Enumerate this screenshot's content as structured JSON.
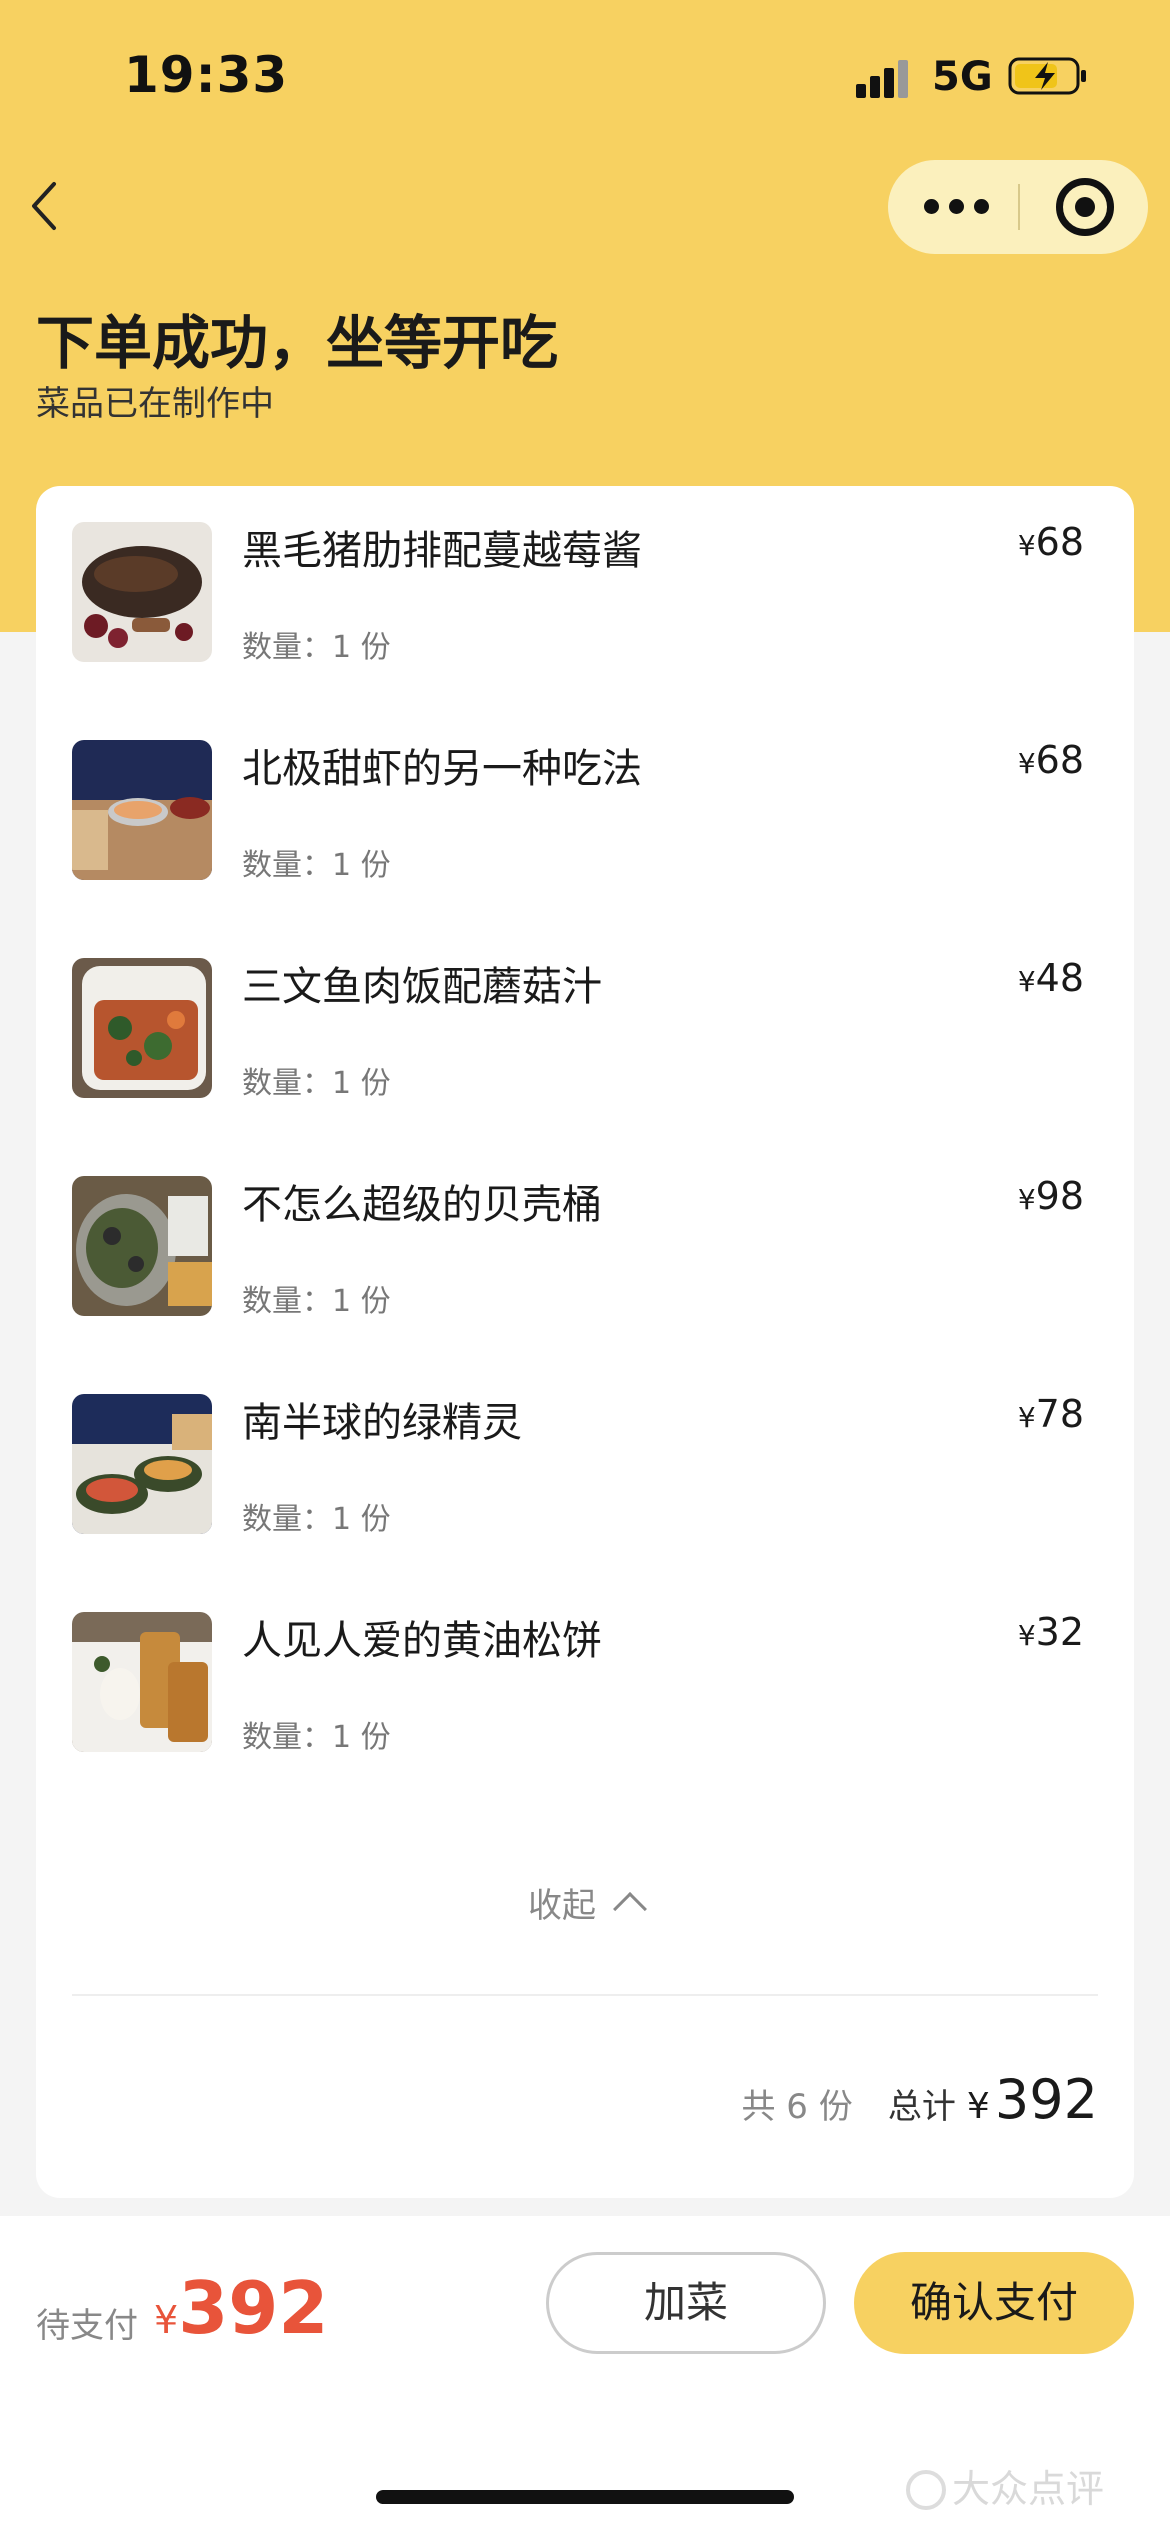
{
  "status_bar": {
    "time": "19:33",
    "network": "5G",
    "icons": [
      "signal-icon",
      "battery-charging-icon"
    ]
  },
  "nav": {
    "back_icon": "chevron-left-icon",
    "capsule_icons": [
      "more-icon",
      "target-icon"
    ]
  },
  "header": {
    "title": "下单成功，坐等开吃",
    "subtitle": "菜品已在制作中"
  },
  "order": {
    "items": [
      {
        "name": "黑毛猪肋排配蔓越莓酱",
        "qty": "数量：1 份",
        "currency": "¥",
        "price": "68"
      },
      {
        "name": "北极甜虾的另一种吃法",
        "qty": "数量：1 份",
        "currency": "¥",
        "price": "68"
      },
      {
        "name": "三文鱼肉饭配蘑菇汁",
        "qty": "数量：1 份",
        "currency": "¥",
        "price": "48"
      },
      {
        "name": "不怎么超级的贝壳桶",
        "qty": "数量：1 份",
        "currency": "¥",
        "price": "98"
      },
      {
        "name": "南半球的绿精灵",
        "qty": "数量：1 份",
        "currency": "¥",
        "price": "78"
      },
      {
        "name": "人见人爱的黄油松饼",
        "qty": "数量：1 份",
        "currency": "¥",
        "price": "32"
      }
    ],
    "collapse_label": "收起",
    "count_label": "共 6 份",
    "total_label": "总计",
    "total_currency": "¥",
    "total": "392"
  },
  "bottom": {
    "pay_label": "待支付",
    "pay_currency": "¥",
    "pay_amount": "392",
    "add_button": "加菜",
    "confirm_button": "确认支付"
  },
  "watermark": "大众点评",
  "colors": {
    "brand_yellow": "#f7d161",
    "price_red": "#e8543a",
    "page_bg": "#f4f4f4"
  }
}
